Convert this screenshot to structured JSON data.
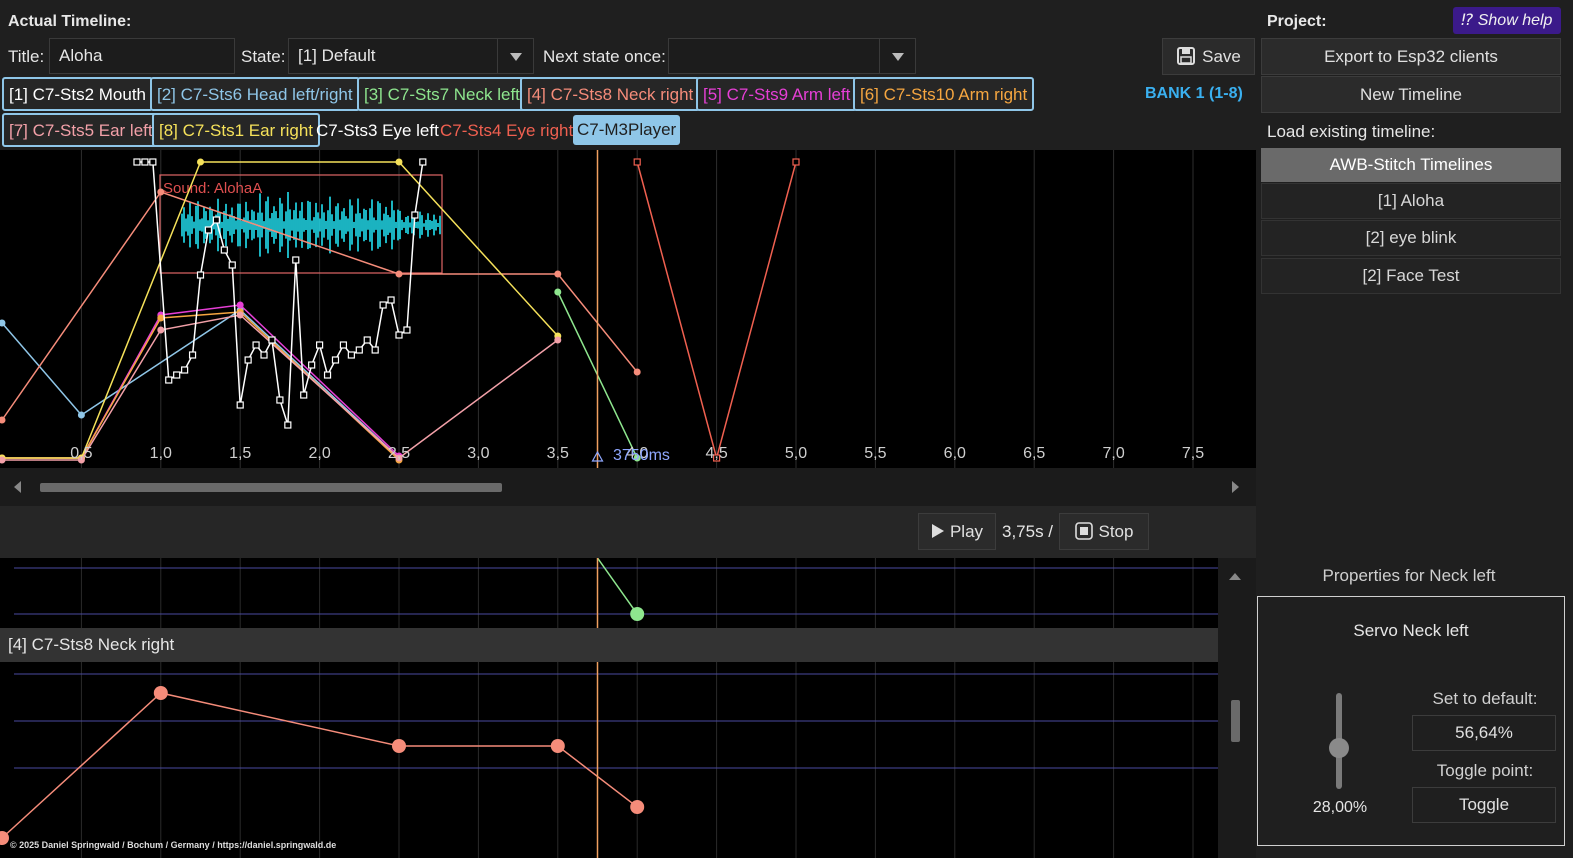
{
  "header": {
    "actual_timeline_label": "Actual Timeline:",
    "title_label": "Title:",
    "title_value": "Aloha",
    "state_label": "State:",
    "state_value": "[1] Default",
    "next_state_label": "Next state once:",
    "next_state_value": "",
    "save_label": "Save",
    "bank_label": "BANK 1 (1-8)"
  },
  "tracks": [
    {
      "label": "[1] C7-Sts2 Mouth",
      "color": "#ffffff"
    },
    {
      "label": "[2] C7-Sts6 Head left/right",
      "color": "#8fc6e8"
    },
    {
      "label": "[3] C7-Sts7 Neck left",
      "color": "#8ee68e"
    },
    {
      "label": "[4] C7-Sts8 Neck right",
      "color": "#f58c7a"
    },
    {
      "label": "[5] C7-Sts9 Arm left",
      "color": "#e63fd6"
    },
    {
      "label": "[6] C7-Sts10 Arm right",
      "color": "#f5a640"
    },
    {
      "label": "[7] C7-Sts5 Ear left",
      "color": "#f2a0a8"
    },
    {
      "label": "[8] C7-Sts1 Ear right",
      "color": "#f5e15a"
    },
    {
      "label": "C7-Sts3 Eye left",
      "color": "#ffffff"
    },
    {
      "label": "C7-Sts4 Eye right",
      "color": "#f06050"
    },
    {
      "label": "C7-M3Player",
      "color": "#1f1f1f"
    }
  ],
  "timeline": {
    "ticks": [
      "0,5",
      "1,0",
      "1,5",
      "2,0",
      "2,5",
      "3,0",
      "3,5",
      "4,0",
      "4,5",
      "5,0",
      "5,5",
      "6,0",
      "6,5",
      "7,0",
      "7,5"
    ],
    "cursor_label": "3750ms",
    "sound_label": "Sound: AlohaA"
  },
  "transport": {
    "play_label": "Play",
    "time_value": "3,75s /",
    "stop_label": "Stop"
  },
  "detail": {
    "track_header": "[4] C7-Sts8 Neck right",
    "copyright": "© 2025 Daniel Springwald / Bochum / Germany / https://daniel.springwald.de"
  },
  "project": {
    "label": "Project:",
    "show_help": "⁉ Show help",
    "export_label": "Export to Esp32 clients",
    "new_timeline_label": "New Timeline",
    "load_label": "Load existing timeline:",
    "group_label": "AWB-Stitch Timelines",
    "timelines": [
      "[1] Aloha",
      "[2] eye blink",
      "[2] Face Test"
    ]
  },
  "properties": {
    "header": "Properties for Neck left",
    "servo_title": "Servo Neck left",
    "slider_value": "28,00%",
    "slider_fraction": 0.28,
    "set_default_label": "Set to default:",
    "default_value": "56,64%",
    "toggle_point_label": "Toggle point:",
    "toggle_label": "Toggle"
  },
  "colors": {
    "accent_bank": "#3ab0f0",
    "help_bg": "#3b1a8a",
    "cursor": "#f0a060"
  }
}
